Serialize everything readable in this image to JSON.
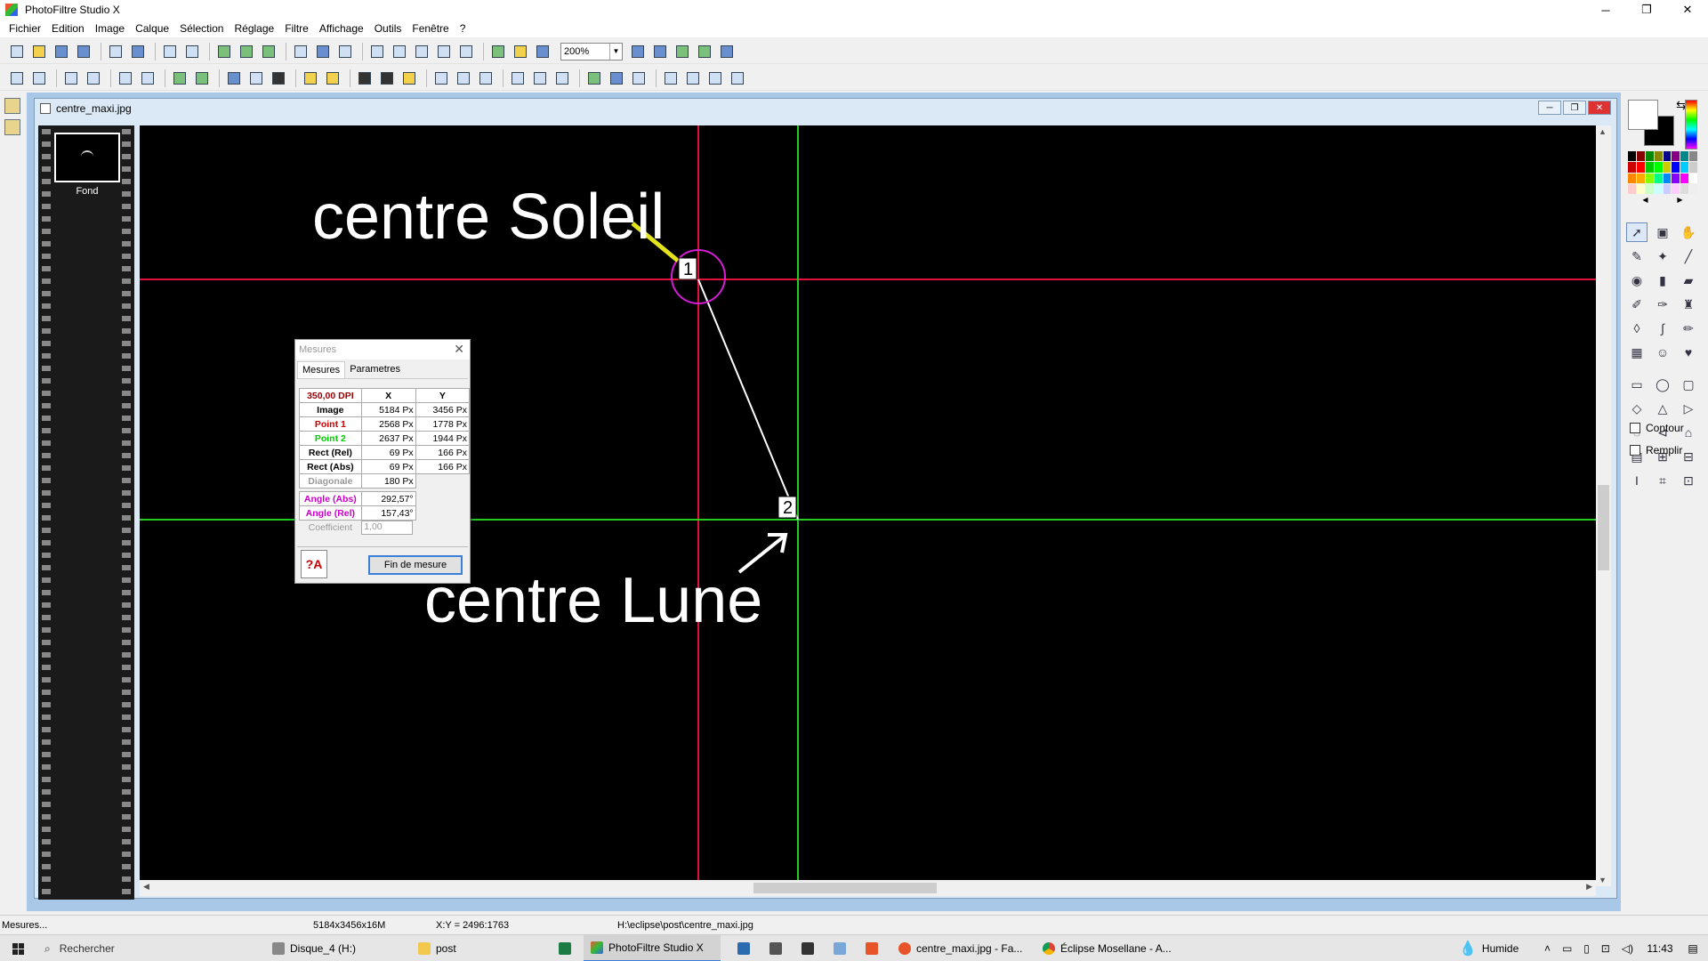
{
  "window": {
    "title": "PhotoFiltre Studio X",
    "minimize": "─",
    "maximize": "❐",
    "close": "✕"
  },
  "menu": [
    "Fichier",
    "Edition",
    "Image",
    "Calque",
    "Sélection",
    "Réglage",
    "Filtre",
    "Affichage",
    "Outils",
    "Fenêtre",
    "?"
  ],
  "toolbar": {
    "zoom_value": "200%"
  },
  "document": {
    "title": "centre_maxi.jpg",
    "layer_name": "Fond",
    "annotation_sun": "centre Soleil",
    "annotation_moon": "centre Lune",
    "marker_1": "1",
    "marker_2": "2",
    "line_colors": {
      "sun_guides": "#e0103a",
      "moon_guides": "#22cc22",
      "circle": "#d51dd5",
      "sun_arrow": "#e3e31c",
      "moon_arrow": "#ffffff"
    }
  },
  "mesures": {
    "title": "Mesures",
    "tabs": [
      "Mesures",
      "Parametres"
    ],
    "dpi_label": "350,00 DPI",
    "col_x": "X",
    "col_y": "Y",
    "rows": [
      {
        "label": "Image",
        "x": "5184 Px",
        "y": "3456 Px"
      },
      {
        "label": "Point 1",
        "x": "2568 Px",
        "y": "1778 Px"
      },
      {
        "label": "Point 2",
        "x": "2637 Px",
        "y": "1944 Px"
      },
      {
        "label": "Rect (Rel)",
        "x": "69 Px",
        "y": "166 Px"
      },
      {
        "label": "Rect (Abs)",
        "x": "69 Px",
        "y": "166 Px"
      }
    ],
    "diagonale_label": "Diagonale",
    "diagonale_value": "180 Px",
    "angle_abs_label": "Angle (Abs)",
    "angle_abs_value": "292,57°",
    "angle_rel_label": "Angle (Rel)",
    "angle_rel_value": "157,43°",
    "coef_label": "Coefficient",
    "coef_value": "1,00",
    "end_button": "Fin de mesure",
    "help_icon_text": "?A"
  },
  "right_panel": {
    "contour_label": "Contour",
    "remplir_label": "Remplir"
  },
  "status": {
    "hint": "Mesures...",
    "size": "5184x3456x16M",
    "xy": "X:Y = 2496:1763",
    "path": "H:\\eclipse\\post\\centre_maxi.jpg"
  },
  "taskbar": {
    "search_placeholder": "Rechercher",
    "items": [
      "Disque_4 (H:)",
      "post",
      "PhotoFiltre Studio X",
      "centre_maxi.jpg - Fa...",
      "Éclipse Mosellane - A..."
    ],
    "weather": "Humide",
    "time": "11:43"
  }
}
